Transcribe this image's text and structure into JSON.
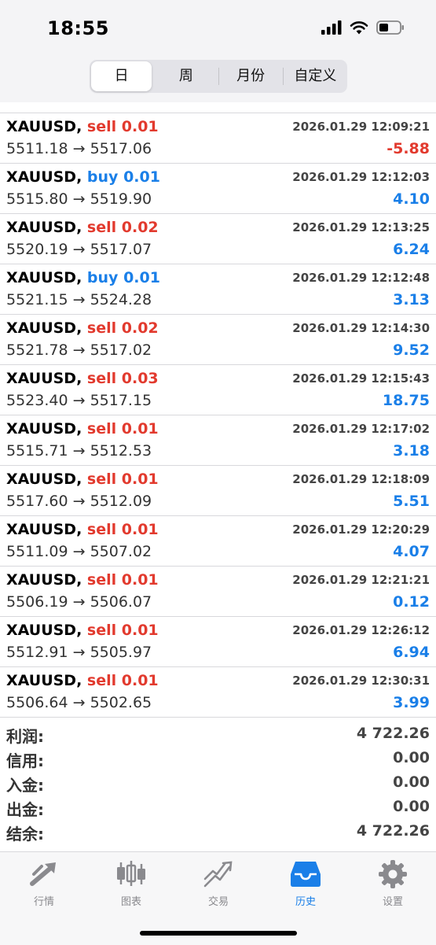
{
  "status_bar": {
    "time": "18:55"
  },
  "segments": [
    {
      "label": "日",
      "active": true
    },
    {
      "label": "周",
      "active": false
    },
    {
      "label": "月份",
      "active": false
    },
    {
      "label": "自定义",
      "active": false
    }
  ],
  "deals": [
    {
      "symbol": "XAUUSD,",
      "side": "sell",
      "volume": "0.01",
      "datetime": "2026.01.29 12:09:21",
      "open": "5511.18",
      "close": "5517.06",
      "profit": "-5.88"
    },
    {
      "symbol": "XAUUSD,",
      "side": "buy",
      "volume": "0.01",
      "datetime": "2026.01.29 12:12:03",
      "open": "5515.80",
      "close": "5519.90",
      "profit": "4.10"
    },
    {
      "symbol": "XAUUSD,",
      "side": "sell",
      "volume": "0.02",
      "datetime": "2026.01.29 12:13:25",
      "open": "5520.19",
      "close": "5517.07",
      "profit": "6.24"
    },
    {
      "symbol": "XAUUSD,",
      "side": "buy",
      "volume": "0.01",
      "datetime": "2026.01.29 12:12:48",
      "open": "5521.15",
      "close": "5524.28",
      "profit": "3.13"
    },
    {
      "symbol": "XAUUSD,",
      "side": "sell",
      "volume": "0.02",
      "datetime": "2026.01.29 12:14:30",
      "open": "5521.78",
      "close": "5517.02",
      "profit": "9.52"
    },
    {
      "symbol": "XAUUSD,",
      "side": "sell",
      "volume": "0.03",
      "datetime": "2026.01.29 12:15:43",
      "open": "5523.40",
      "close": "5517.15",
      "profit": "18.75"
    },
    {
      "symbol": "XAUUSD,",
      "side": "sell",
      "volume": "0.01",
      "datetime": "2026.01.29 12:17:02",
      "open": "5515.71",
      "close": "5512.53",
      "profit": "3.18"
    },
    {
      "symbol": "XAUUSD,",
      "side": "sell",
      "volume": "0.01",
      "datetime": "2026.01.29 12:18:09",
      "open": "5517.60",
      "close": "5512.09",
      "profit": "5.51"
    },
    {
      "symbol": "XAUUSD,",
      "side": "sell",
      "volume": "0.01",
      "datetime": "2026.01.29 12:20:29",
      "open": "5511.09",
      "close": "5507.02",
      "profit": "4.07"
    },
    {
      "symbol": "XAUUSD,",
      "side": "sell",
      "volume": "0.01",
      "datetime": "2026.01.29 12:21:21",
      "open": "5506.19",
      "close": "5506.07",
      "profit": "0.12"
    },
    {
      "symbol": "XAUUSD,",
      "side": "sell",
      "volume": "0.01",
      "datetime": "2026.01.29 12:26:12",
      "open": "5512.91",
      "close": "5505.97",
      "profit": "6.94"
    },
    {
      "symbol": "XAUUSD,",
      "side": "sell",
      "volume": "0.01",
      "datetime": "2026.01.29 12:30:31",
      "open": "5506.64",
      "close": "5502.65",
      "profit": "3.99"
    }
  ],
  "arrow": "→",
  "summary": [
    {
      "label": "利润:",
      "value": "4 722.26"
    },
    {
      "label": "信用:",
      "value": "0.00"
    },
    {
      "label": "入金:",
      "value": "0.00"
    },
    {
      "label": "出金:",
      "value": "0.00"
    },
    {
      "label": "结余:",
      "value": "4 722.26"
    }
  ],
  "tabbar": [
    {
      "label": "行情",
      "icon": "quotes-icon",
      "active": false
    },
    {
      "label": "图表",
      "icon": "chart-icon",
      "active": false
    },
    {
      "label": "交易",
      "icon": "trade-icon",
      "active": false
    },
    {
      "label": "历史",
      "icon": "history-icon",
      "active": true
    },
    {
      "label": "设置",
      "icon": "settings-icon",
      "active": false
    }
  ],
  "colors": {
    "sell": "#e23a2e",
    "buy": "#1a7fe8",
    "active_tab": "#1a7fe8",
    "inactive_tab": "#8a8a8e"
  }
}
